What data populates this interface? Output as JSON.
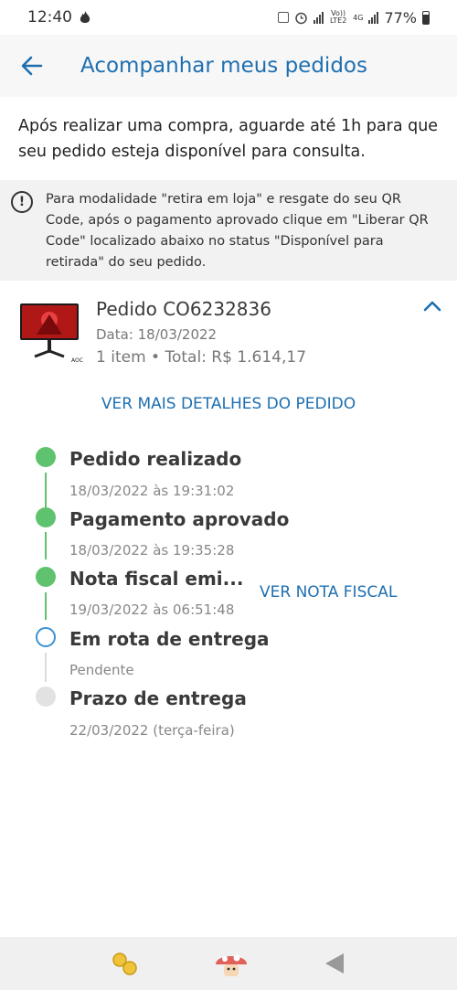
{
  "status_bar": {
    "time": "12:40",
    "network": "Vo)) LTE2",
    "network_type": "4G",
    "battery": "77%"
  },
  "header": {
    "title": "Acompanhar meus pedidos"
  },
  "intro_text": "Após realizar uma compra, aguarde até 1h para que seu pedido esteja disponível para consulta.",
  "notice": {
    "icon": "info-icon",
    "text": "Para modalidade \"retira em loja\" e resgate do seu QR Code, após o pagamento aprovado clique em \"Liberar QR Code\" localizado abaixo no status \"Disponível para retirada\" do seu pedido."
  },
  "order": {
    "id": "Pedido CO6232836",
    "date": "Data: 18/03/2022",
    "summary": "1 item • Total: R$ 1.614,17",
    "details_link": "VER MAIS DETALHES DO PEDIDO",
    "thumbnail_brand": "AOC"
  },
  "timeline": [
    {
      "title": "Pedido realizado",
      "subtitle": "18/03/2022 às 19:31:02",
      "state": "done"
    },
    {
      "title": "Pagamento aprovado",
      "subtitle": "18/03/2022 às 19:35:28",
      "state": "done"
    },
    {
      "title": "Nota fiscal emi...",
      "subtitle": "19/03/2022 às 06:51:48",
      "state": "done",
      "action": "VER NOTA FISCAL"
    },
    {
      "title": "Em rota de entrega",
      "subtitle": "Pendente",
      "state": "current"
    },
    {
      "title": "Prazo de entrega",
      "subtitle": "22/03/2022 (terça-feira)",
      "state": "future"
    }
  ],
  "colors": {
    "accent": "#1e6fb0",
    "done": "#5fc26e",
    "current": "#3a92d4",
    "future": "#e2e2e2"
  }
}
